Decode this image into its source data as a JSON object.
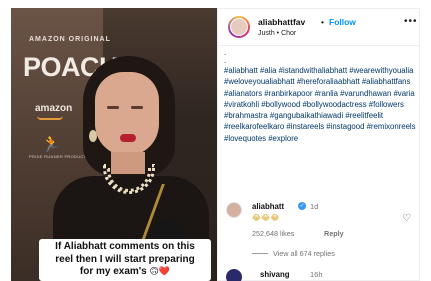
{
  "video": {
    "brand_top": "AMAZON ORIGINAL",
    "brand_title": "POACH",
    "brand_amazon": "amazon",
    "runner_icon": "runner-logo-icon",
    "runner_caption": "PRIDE RUNNER PRODUCTIONS",
    "caption_line1": "If Aliabhatt comments on this",
    "caption_line2": "reel then I will start preparing",
    "caption_line3": "for my exam's",
    "caption_emoji": "🙃❤️"
  },
  "post": {
    "handle": "aliabhattfav",
    "separator": "•",
    "follow_label": "Follow",
    "subtitle": "Justh • Chor",
    "more_label": "•••",
    "caption_dots": [
      ".",
      "."
    ],
    "hashtags": "#aliabhatt #alia #istandwithaliabhatt #wearewithyoualia #weloveyoualiabhatt #hereforaliaabhatt #aliabhattfans #alianators #ranbirkapoor #ranlia #varundhawan #varia #viratkohli #bollywood #bollywoodactress #followers #brahmastra #gangubaikathiawadi #reelitfeelit #reelkarofeelkaro #instareels #instagood #remixonreels #lovequotes #explore"
  },
  "comment": {
    "handle": "aliabhatt",
    "verified_mark": "✓",
    "time": "1d",
    "text": "😂😂😂",
    "likes": "252,648 likes",
    "reply_label": "Reply",
    "view_replies": "View all 674 replies"
  },
  "comment2": {
    "handle": "shivang",
    "time": "16h"
  },
  "colors": {
    "follow_blue": "#0095f6",
    "hashtag": "#00376b",
    "verified": "#3897f0"
  }
}
